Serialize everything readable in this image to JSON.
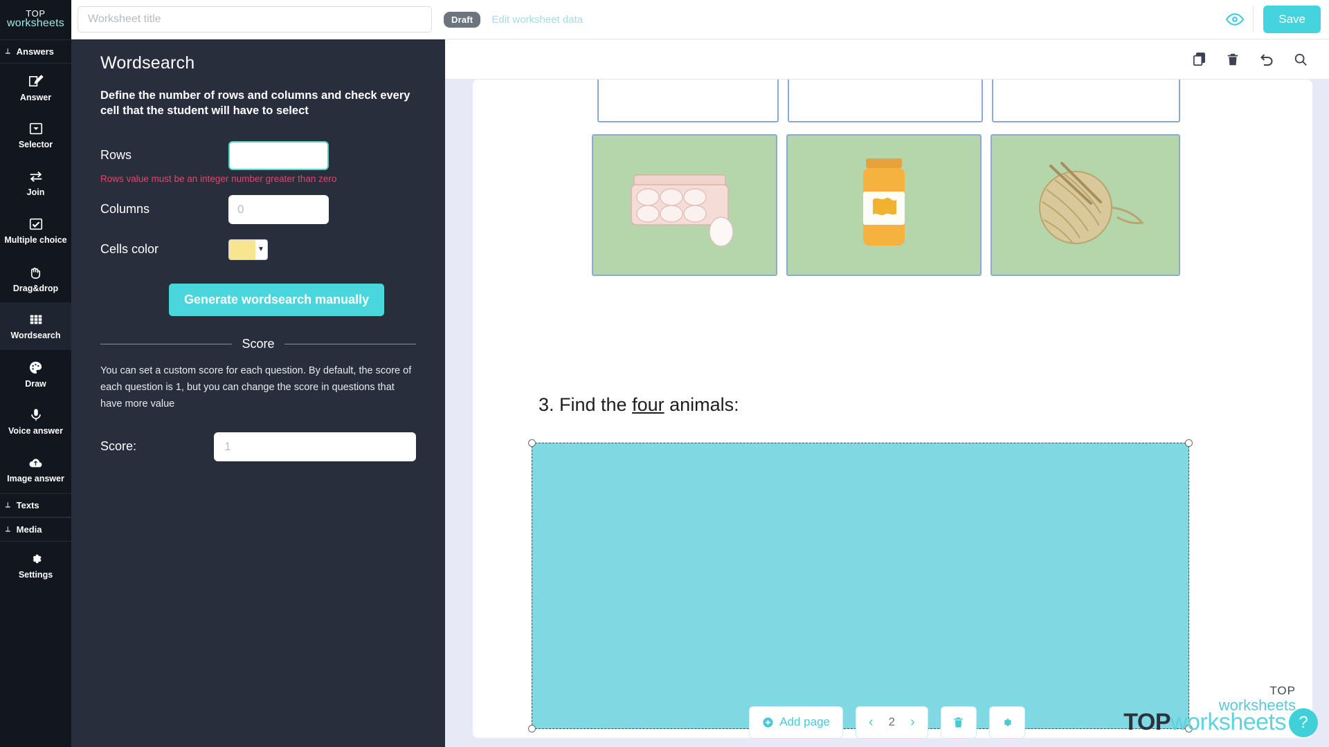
{
  "brand": {
    "line1": "TOP",
    "line2": "worksheets"
  },
  "header": {
    "title_placeholder": "Worksheet title",
    "title_value": "",
    "status_badge": "Draft",
    "edit_link": "Edit worksheet data",
    "preview_icon": "eye-icon",
    "save_label": "Save",
    "save_color": "#45d3dd"
  },
  "sidebar": {
    "sections": [
      {
        "label": "Answers",
        "expanded": true
      },
      {
        "label": "Texts",
        "expanded": false
      },
      {
        "label": "Media",
        "expanded": false
      }
    ],
    "items": [
      {
        "label": "Answer",
        "icon": "pencil-square-icon",
        "active": false
      },
      {
        "label": "Selector",
        "icon": "dropdown-icon",
        "active": false
      },
      {
        "label": "Join",
        "icon": "arrows-exchange-icon",
        "active": false
      },
      {
        "label": "Multiple choice",
        "icon": "checkbox-icon",
        "active": false
      },
      {
        "label": "Drag&drop",
        "icon": "hand-icon",
        "active": false
      },
      {
        "label": "Wordsearch",
        "icon": "grid-icon",
        "active": true
      },
      {
        "label": "Draw",
        "icon": "palette-icon",
        "active": false
      },
      {
        "label": "Voice answer",
        "icon": "microphone-icon",
        "active": false
      },
      {
        "label": "Image answer",
        "icon": "cloud-upload-icon",
        "active": false
      }
    ],
    "settings": {
      "label": "Settings",
      "icon": "gear-icon"
    }
  },
  "panel": {
    "title": "Wordsearch",
    "description": "Define the number of rows and columns and check every cell that the student will have to select",
    "rows_label": "Rows",
    "rows_value": "",
    "rows_placeholder": "",
    "rows_error": "Rows value must be an integer number greater than zero",
    "columns_label": "Columns",
    "columns_value": "",
    "columns_placeholder": "0",
    "cells_color_label": "Cells color",
    "cells_color_value": "#f7e590",
    "generate_button": "Generate wordsearch manually",
    "score_separator": "Score",
    "score_description": "You can set a custom score for each question. By default, the score of each question is 1, but you can change the score in questions that have more value",
    "score_label": "Score:",
    "score_value": "",
    "score_placeholder": "1"
  },
  "canvas_toolbar": {
    "copy_icon": "copy-icon",
    "delete_icon": "trash-icon",
    "undo_icon": "undo-icon",
    "zoom_icon": "search-icon"
  },
  "worksheet": {
    "question_prefix": "3. Find the ",
    "question_underlined": "four",
    "question_suffix": " animals:",
    "selection_color": "#7fd8e2",
    "image_row_top": [
      {
        "name": "blank-cell-1"
      },
      {
        "name": "blank-cell-2"
      },
      {
        "name": "blank-cell-3"
      }
    ],
    "image_row_bottom": [
      {
        "name": "egg-carton-image"
      },
      {
        "name": "honey-jar-image"
      },
      {
        "name": "yarn-ball-image"
      }
    ],
    "page_logo": {
      "line1": "TOP",
      "line2": "worksheets"
    }
  },
  "bottom_bar": {
    "add_page_label": "Add page",
    "page_number": "2",
    "prev_arrow": "‹",
    "next_arrow": "›",
    "delete_page_icon": "trash-icon",
    "page_settings_icon": "gear-icon",
    "logo_part1": "TOP",
    "logo_part2": "worksheets",
    "help_label": "?"
  }
}
